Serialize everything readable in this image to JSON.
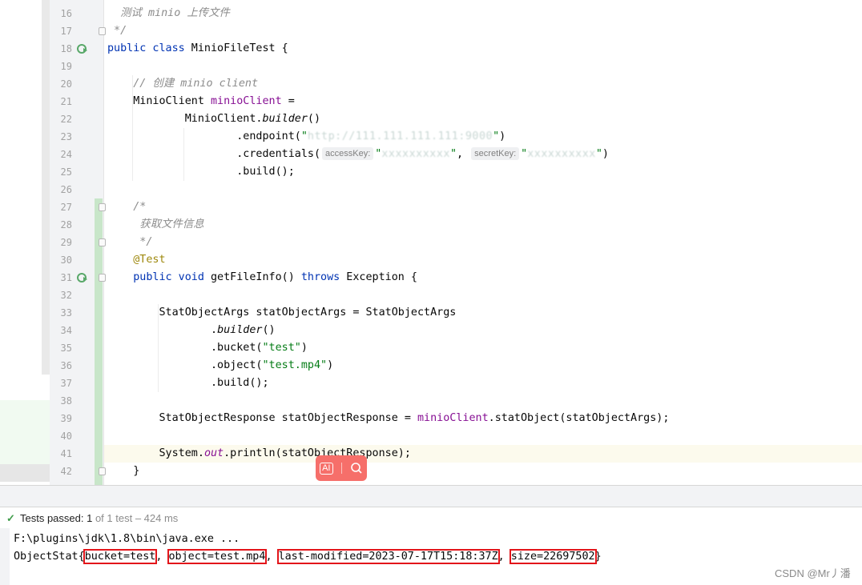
{
  "editor": {
    "lines": [
      {
        "n": "16",
        "parts": [
          {
            "t": "  测试 minio 上传文件",
            "c": "cm"
          }
        ]
      },
      {
        "n": "17",
        "parts": [
          {
            "t": " */",
            "c": "cm"
          }
        ]
      },
      {
        "n": "18",
        "parts": [
          {
            "t": "public class",
            "c": "kw"
          },
          {
            "t": " MinioFileTest {",
            "c": ""
          }
        ]
      },
      {
        "n": "19",
        "parts": []
      },
      {
        "n": "20",
        "parts": [
          {
            "t": "    // 创建 minio client",
            "c": "cm"
          }
        ]
      },
      {
        "n": "21",
        "parts": [
          {
            "t": "    MinioClient ",
            "c": ""
          },
          {
            "t": "minioClient",
            "c": "fld"
          },
          {
            "t": " =",
            "c": ""
          }
        ]
      },
      {
        "n": "22",
        "parts": [
          {
            "t": "            MinioClient.",
            "c": ""
          },
          {
            "t": "builder",
            "c": "it"
          },
          {
            "t": "()",
            "c": ""
          }
        ]
      },
      {
        "n": "23",
        "parts": [
          {
            "t": "                    .endpoint(",
            "c": ""
          },
          {
            "t": "\"",
            "c": "str"
          },
          {
            "t": "http://111.111.111.111:9000",
            "c": "blur"
          },
          {
            "t": "\"",
            "c": "str"
          },
          {
            "t": ")",
            "c": ""
          }
        ]
      },
      {
        "n": "24",
        "parts": [
          {
            "t": "                    .credentials(",
            "c": ""
          },
          {
            "t": "accessKey:",
            "c": "hint"
          },
          {
            "t": "\"",
            "c": "str"
          },
          {
            "t": "xxxxxxxxxx",
            "c": "blur"
          },
          {
            "t": "\"",
            "c": "str"
          },
          {
            "t": ", ",
            "c": ""
          },
          {
            "t": "secretKey:",
            "c": "hint"
          },
          {
            "t": "\"",
            "c": "str"
          },
          {
            "t": "xxxxxxxxxx",
            "c": "blur"
          },
          {
            "t": "\"",
            "c": "str"
          },
          {
            "t": ")",
            "c": ""
          }
        ]
      },
      {
        "n": "25",
        "parts": [
          {
            "t": "                    .build();",
            "c": ""
          }
        ]
      },
      {
        "n": "26",
        "parts": []
      },
      {
        "n": "27",
        "parts": [
          {
            "t": "    /*",
            "c": "cm"
          }
        ]
      },
      {
        "n": "28",
        "parts": [
          {
            "t": "     获取文件信息",
            "c": "cm"
          }
        ]
      },
      {
        "n": "29",
        "parts": [
          {
            "t": "     */",
            "c": "cm"
          }
        ]
      },
      {
        "n": "30",
        "parts": [
          {
            "t": "    @Test",
            "c": "ann"
          }
        ]
      },
      {
        "n": "31",
        "parts": [
          {
            "t": "    public void",
            "c": "kw"
          },
          {
            "t": " getFileInfo() ",
            "c": ""
          },
          {
            "t": "throws",
            "c": "kw"
          },
          {
            "t": " Exception {",
            "c": ""
          }
        ]
      },
      {
        "n": "32",
        "parts": []
      },
      {
        "n": "33",
        "parts": [
          {
            "t": "        StatObjectArgs statObjectArgs = StatObjectArgs",
            "c": ""
          }
        ]
      },
      {
        "n": "34",
        "parts": [
          {
            "t": "                .",
            "c": ""
          },
          {
            "t": "builder",
            "c": "it"
          },
          {
            "t": "()",
            "c": ""
          }
        ]
      },
      {
        "n": "35",
        "parts": [
          {
            "t": "                .bucket(",
            "c": ""
          },
          {
            "t": "\"test\"",
            "c": "str"
          },
          {
            "t": ")",
            "c": ""
          }
        ]
      },
      {
        "n": "36",
        "parts": [
          {
            "t": "                .object(",
            "c": ""
          },
          {
            "t": "\"test.mp4\"",
            "c": "str"
          },
          {
            "t": ")",
            "c": ""
          }
        ]
      },
      {
        "n": "37",
        "parts": [
          {
            "t": "                .build();",
            "c": ""
          }
        ]
      },
      {
        "n": "38",
        "parts": []
      },
      {
        "n": "39",
        "parts": [
          {
            "t": "        StatObjectResponse statObjectResponse = ",
            "c": ""
          },
          {
            "t": "minioClient",
            "c": "fld"
          },
          {
            "t": ".statObject(statObjectArgs);",
            "c": ""
          }
        ]
      },
      {
        "n": "40",
        "parts": []
      },
      {
        "n": "41",
        "parts": [
          {
            "t": "        System.",
            "c": ""
          },
          {
            "t": "out",
            "c": "fld it"
          },
          {
            "t": ".println(statObjectResponse);",
            "c": ""
          }
        ]
      },
      {
        "n": "42",
        "parts": [
          {
            "t": "    }",
            "c": ""
          }
        ]
      }
    ]
  },
  "status": {
    "check_icon": "check-icon",
    "passed_label": "Tests passed: ",
    "passed_count": "1",
    "total_text": " of 1 test – 424 ms"
  },
  "console": {
    "line1": "F:\\plugins\\jdk\\1.8\\bin\\java.exe ...",
    "prefix": "ObjectStat{",
    "bucket": "bucket=test",
    "sep1": ", ",
    "object": "object=test.mp4",
    "sep2": ", ",
    "modified": "last-modified=2023-07-17T15:18:37Z",
    "sep3": ", ",
    "size": "size=22697502",
    "suffix": "}"
  },
  "watermark": "CSDN @Mr丿潘",
  "colors": {
    "keyword": "#0033b3",
    "comment": "#8c8c8c",
    "field": "#871094",
    "string": "#067d17",
    "annotation": "#9e880d",
    "highlight_box": "#e3151a"
  }
}
